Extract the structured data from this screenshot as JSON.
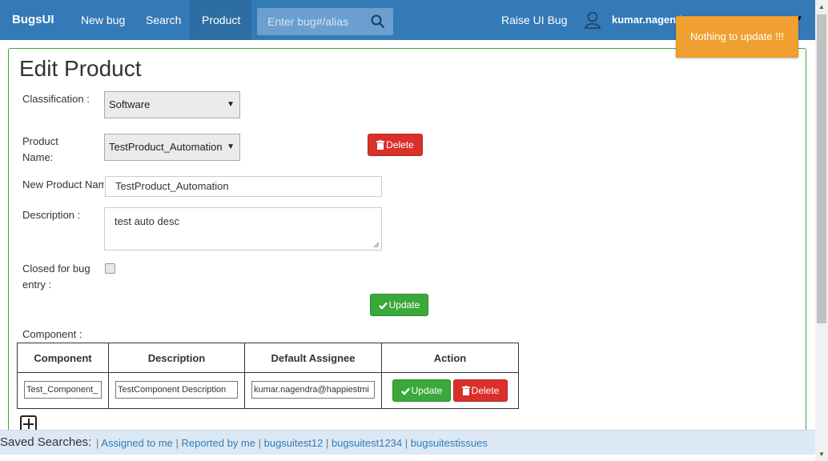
{
  "nav": {
    "brand": "BugsUI",
    "links": [
      "New bug",
      "Search",
      "Product"
    ],
    "search_placeholder": "Enter bug#/alias",
    "raise": "Raise UI Bug",
    "user": "kumar.nagendra"
  },
  "toast": "Nothing to update !!!",
  "page_title": "Edit Product",
  "form": {
    "classification_label": "Classification :",
    "classification_value": "Software",
    "product_name_label": "Product Name:",
    "product_name_value": "TestProduct_Automation",
    "delete_label": "Delete",
    "new_product_label": "New Product Name",
    "new_product_value": "TestProduct_Automation",
    "description_label": "Description :",
    "description_value": "test auto desc",
    "closed_label": "Closed for bug entry :",
    "update_label": "Update"
  },
  "component": {
    "section_label": "Component :",
    "headers": [
      "Component",
      "Description",
      "Default Assignee",
      "Action"
    ],
    "row": {
      "component": "Test_Component_",
      "description": "TestComponent Description",
      "assignee": "kumar.nagendra@happiestmi",
      "update": "Update",
      "delete": "Delete"
    }
  },
  "footer": {
    "label": "Saved Searches:",
    "links": [
      "Assigned to me",
      "Reported by me",
      "bugsuitest12",
      "bugsuitest1234",
      "bugsuitestissues"
    ]
  },
  "colors": {
    "nav": "#337ab7",
    "toast": "#f0a030",
    "green": "#3aa83a",
    "red": "#d9302c"
  }
}
